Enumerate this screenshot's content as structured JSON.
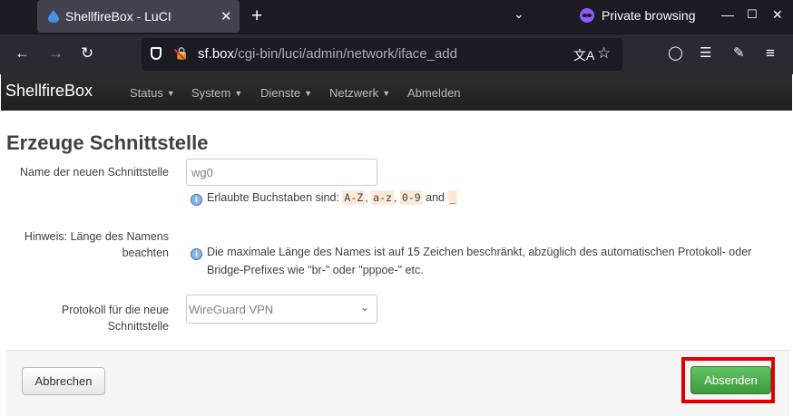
{
  "browser": {
    "tab_title": "ShellfireBox - LuCI",
    "close_glyph": "✕",
    "newtab_glyph": "+",
    "private_label": "Private browsing",
    "url_host": "sf.box",
    "url_path": "/cgi-bin/luci/admin/network/iface_add",
    "accent_private": "#9059ff"
  },
  "luci": {
    "brand": "ShellfireBox",
    "menu": [
      {
        "label": "Status"
      },
      {
        "label": "System"
      },
      {
        "label": "Dienste"
      },
      {
        "label": "Netzwerk"
      },
      {
        "label": "Abmelden"
      }
    ]
  },
  "form": {
    "title": "Erzeuge Schnittstelle",
    "name_label": "Name der neuen Schnittstelle",
    "name_value": "wg0",
    "name_help_prefix": "Erlaubte Buchstaben sind:",
    "name_help_codes": [
      "A-Z",
      "a-z",
      "0-9",
      "_"
    ],
    "name_help_and": "and",
    "hint_label_line1": "Hinweis: Länge des Namens",
    "hint_label_line2": "beachten",
    "hint_text_line1": "Die maximale Länge des Names ist auf 15 Zeichen beschränkt, abzüglich des automatischen Protokoll- oder",
    "hint_text_line2": "Bridge-Prefixes wie \"br-\" oder \"pppoe-\" etc.",
    "proto_label_line1": "Protokoll für die neue",
    "proto_label_line2": "Schnittstelle",
    "proto_value": "WireGuard VPN"
  },
  "footer": {
    "cancel_label": "Abbrechen",
    "submit_label": "Absenden",
    "submit_color": "#4cae4c",
    "highlight_color": "#e00000"
  }
}
